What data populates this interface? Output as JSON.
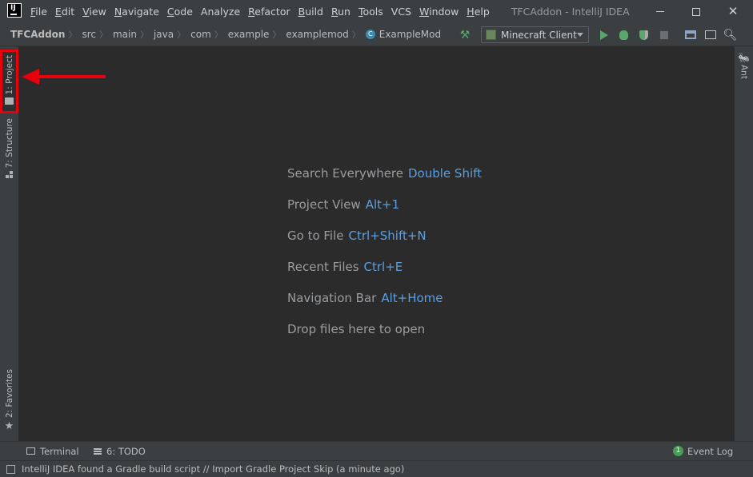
{
  "menubar": {
    "items": [
      {
        "label": "File",
        "mnemonic": "F",
        "rest": "ile"
      },
      {
        "label": "Edit",
        "mnemonic": "E",
        "rest": "dit"
      },
      {
        "label": "View",
        "mnemonic": "V",
        "rest": "iew"
      },
      {
        "label": "Navigate",
        "mnemonic": "N",
        "rest": "avigate"
      },
      {
        "label": "Code",
        "mnemonic": "C",
        "rest": "ode"
      },
      {
        "label": "Analyze",
        "mnemonic": "",
        "rest": "Analyze"
      },
      {
        "label": "Refactor",
        "mnemonic": "R",
        "rest": "efactor"
      },
      {
        "label": "Build",
        "mnemonic": "B",
        "rest": "uild"
      },
      {
        "label": "Run",
        "mnemonic": "R",
        "rest": "un"
      },
      {
        "label": "Tools",
        "mnemonic": "T",
        "rest": "ools"
      },
      {
        "label": "VCS",
        "mnemonic": "",
        "rest": "VCS"
      },
      {
        "label": "Window",
        "mnemonic": "W",
        "rest": "indow"
      },
      {
        "label": "Help",
        "mnemonic": "H",
        "rest": "elp"
      }
    ],
    "window_title": "TFCAddon - IntelliJ IDEA"
  },
  "navbar": {
    "crumbs": [
      "TFCAddon",
      "src",
      "main",
      "java",
      "com",
      "example",
      "examplemod"
    ],
    "current_file": "ExampleMod",
    "class_icon_letter": "C",
    "run_config": "Minecraft Client"
  },
  "left_strip": {
    "project_tab": "1: Project",
    "structure_tab": "7: Structure",
    "favorites_tab": "2: Favorites"
  },
  "right_strip": {
    "ant_tab": "Ant"
  },
  "editor": {
    "hints": [
      {
        "label": "Search Everywhere",
        "key": "Double Shift"
      },
      {
        "label": "Project View",
        "key": "Alt+1"
      },
      {
        "label": "Go to File",
        "key": "Ctrl+Shift+N"
      },
      {
        "label": "Recent Files",
        "key": "Ctrl+E"
      },
      {
        "label": "Navigation Bar",
        "key": "Alt+Home"
      },
      {
        "label": "Drop files here to open",
        "key": ""
      }
    ]
  },
  "bottom_tools": {
    "terminal": "Terminal",
    "todo": "6: TODO",
    "event_log": "Event Log",
    "event_count": "1"
  },
  "status": {
    "message": "IntelliJ IDEA found a Gradle build script // Import Gradle Project   Skip (a minute ago)"
  },
  "colors": {
    "accent_key": "#5c9fe0",
    "annotation": "#e8000a",
    "run_green": "#59a869"
  }
}
